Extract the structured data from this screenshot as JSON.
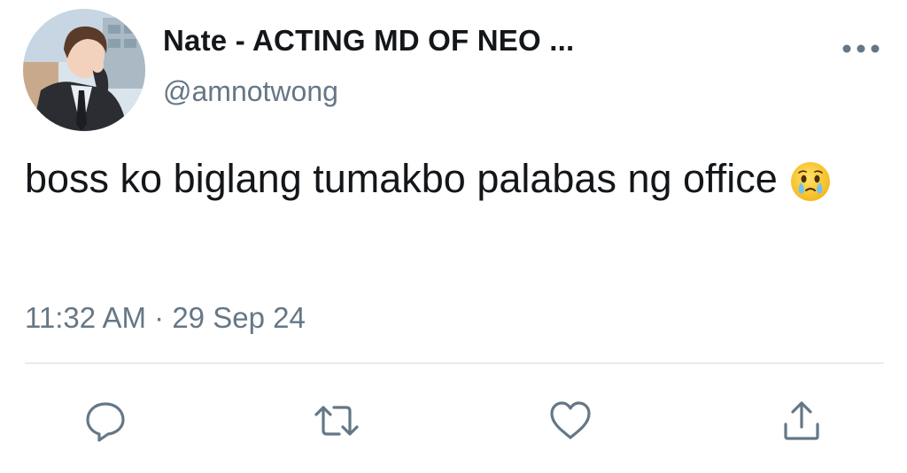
{
  "author": {
    "display_name": "Nate - ACTING MD OF NEO ...",
    "handle": "@amnotwong"
  },
  "tweet": {
    "text": "boss ko biglang tumakbo palabas ng office",
    "emoji": "face-holding-back-tears",
    "time": "11:32 AM",
    "separator": "·",
    "date": "29 Sep 24"
  },
  "actions": [
    {
      "icon": "reply-icon"
    },
    {
      "icon": "retweet-icon"
    },
    {
      "icon": "like-icon"
    },
    {
      "icon": "share-icon"
    }
  ],
  "colors": {
    "text": "#14171a",
    "secondary": "#657786",
    "divider": "#e6ecf0",
    "emoji_yellow": "#fcc21b",
    "tear_blue": "#6fc3f0"
  }
}
